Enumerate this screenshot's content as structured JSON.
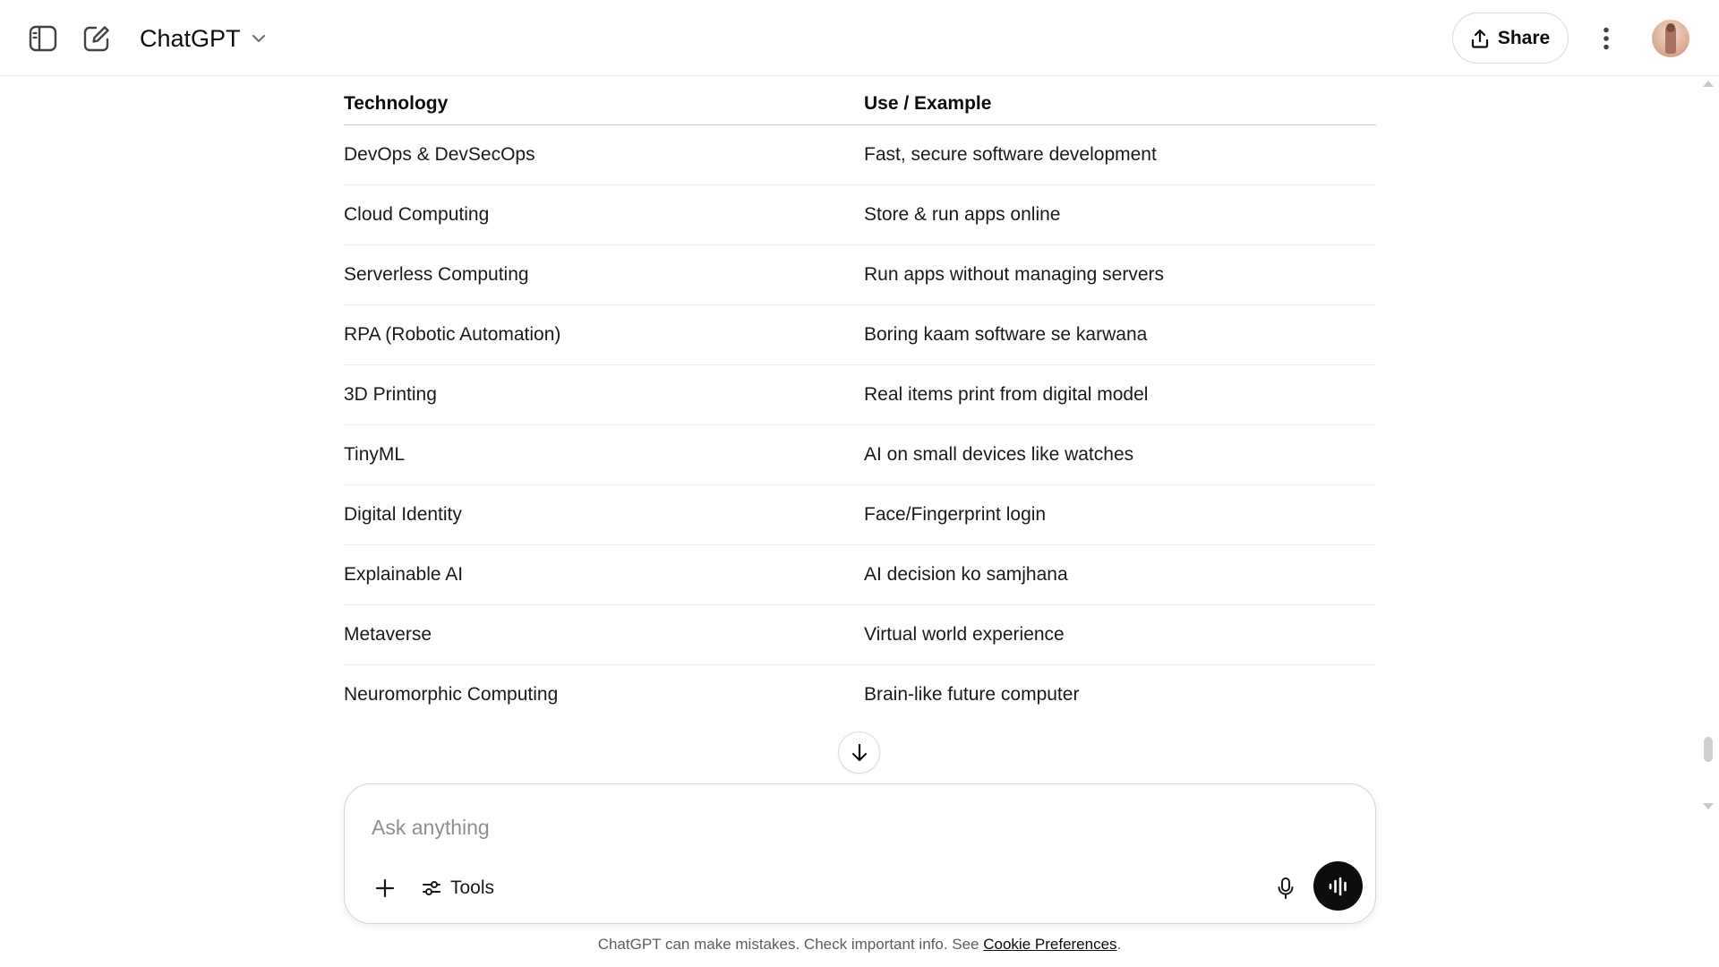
{
  "header": {
    "sidebar_toggle_icon": "sidebar-toggle-icon",
    "new_chat_icon": "new-chat-icon",
    "model_name": "ChatGPT",
    "share_label": "Share",
    "more_icon": "vertical-dots-icon"
  },
  "table": {
    "headers": [
      "Technology",
      "Use / Example"
    ],
    "rows": [
      [
        "DevOps & DevSecOps",
        "Fast, secure software development"
      ],
      [
        "Cloud Computing",
        "Store & run apps online"
      ],
      [
        "Serverless Computing",
        "Run apps without managing servers"
      ],
      [
        "RPA (Robotic Automation)",
        "Boring kaam software se karwana"
      ],
      [
        "3D Printing",
        "Real items print from digital model"
      ],
      [
        "TinyML",
        "AI on small devices like watches"
      ],
      [
        "Digital Identity",
        "Face/Fingerprint login"
      ],
      [
        "Explainable AI",
        "AI decision ko samjhana"
      ],
      [
        "Metaverse",
        "Virtual world experience"
      ],
      [
        "Neuromorphic Computing",
        "Brain-like future computer"
      ]
    ]
  },
  "composer": {
    "placeholder": "Ask anything",
    "tools_label": "Tools"
  },
  "footer": {
    "note": "ChatGPT can make mistakes. Check important info. See ",
    "link": "Cookie Preferences",
    "end": "."
  },
  "colors": {
    "voice_button": "#0d0d0d",
    "border": "#d6d6d6"
  }
}
